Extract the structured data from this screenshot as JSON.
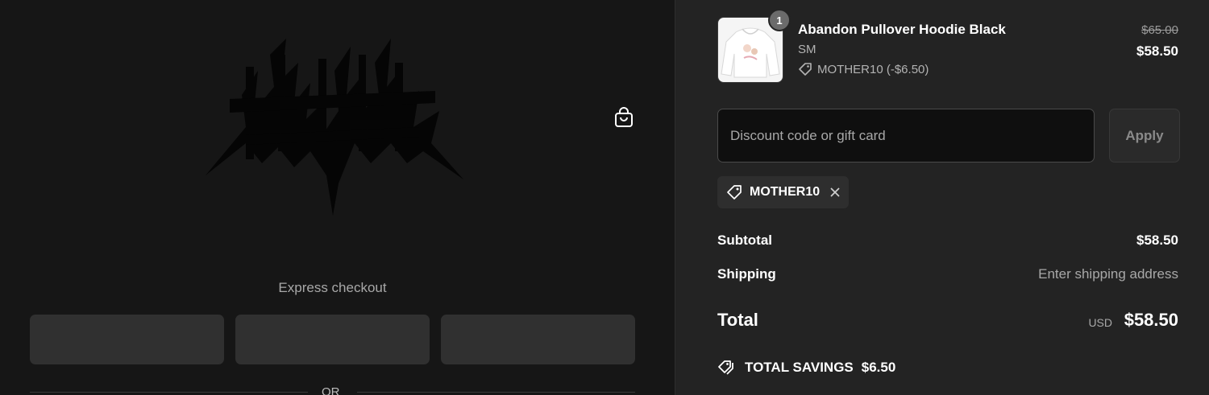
{
  "express": {
    "label": "Express checkout",
    "or_text": "OR"
  },
  "cart": {
    "quantity": "1",
    "product_name": "Abandon Pullover Hoodie Black",
    "variant": "SM",
    "applied_discount": "MOTHER10 (-$6.50)",
    "original_price": "$65.00",
    "price": "$58.50"
  },
  "discount": {
    "placeholder": "Discount code or gift card",
    "apply_label": "Apply",
    "code": "MOTHER10"
  },
  "summary": {
    "subtotal_label": "Subtotal",
    "subtotal_value": "$58.50",
    "shipping_label": "Shipping",
    "shipping_value": "Enter shipping address",
    "total_label": "Total",
    "currency": "USD",
    "total_value": "$58.50",
    "savings_label": "TOTAL SAVINGS",
    "savings_value": "$6.50"
  },
  "icons": {
    "cart": "shopping-bag-icon",
    "tag": "tag-icon",
    "remove": "close-icon",
    "savings": "tags-icon"
  },
  "colors": {
    "left_bg": "#161616",
    "right_bg": "#232323",
    "button_bg": "#303030",
    "input_bg": "#0f0f0f"
  }
}
